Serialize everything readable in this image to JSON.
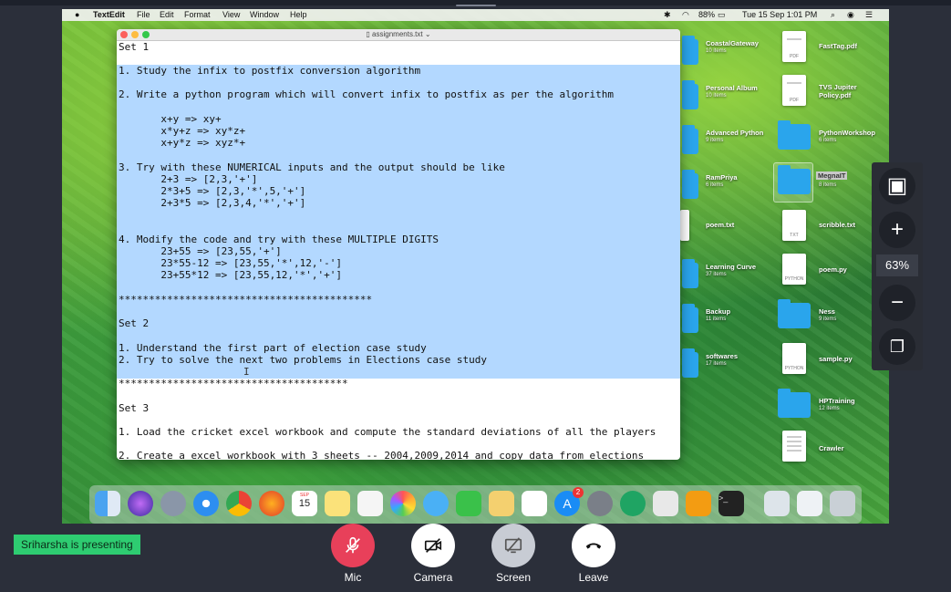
{
  "menubar": {
    "apple": "",
    "app_name": "TextEdit",
    "items": [
      "File",
      "Edit",
      "Format",
      "View",
      "Window",
      "Help"
    ],
    "battery": "88%",
    "datetime": "Tue 15 Sep  1:01 PM"
  },
  "editor": {
    "title": "assignments.txt",
    "lines": [
      "Set 1",
      "",
      "1. Study the infix to postfix conversion algorithm",
      "",
      "2. Write a python program which will convert infix to postfix as per the algorithm",
      "",
      "       x+y => xy+",
      "       x*y+z => xy*z+",
      "       x+y*z => xyz*+",
      "",
      "3. Try with these NUMERICAL inputs and the output should be like",
      "       2+3 => [2,3,'+']",
      "       2*3+5 => [2,3,'*',5,'+']",
      "       2+3*5 => [2,3,4,'*','+']",
      "",
      "",
      "4. Modify the code and try with these MULTIPLE DIGITS",
      "       23+55 => [23,55,'+']",
      "       23*55-12 => [23,55,'*',12,'-']",
      "       23+55*12 => [23,55,12,'*','+']",
      "",
      "******************************************",
      "",
      "Set 2",
      "",
      "1. Understand the first part of election case study",
      "2. Try to solve the next two problems in Elections case study",
      "",
      "**************************************",
      "",
      "Set 3",
      "",
      "1. Load the cricket excel workbook and compute the standard deviations of all the players",
      "",
      "2. Create a excel workbook with 3 sheets -- 2004,2009,2014 and copy data from elections"
    ]
  },
  "desktop": {
    "col1": [
      {
        "name": "CoastalGateway",
        "sub": "10 items"
      },
      {
        "name": "Personal Album",
        "sub": "10 items"
      },
      {
        "name": "Advanced Python",
        "sub": "9 items"
      },
      {
        "name": "RamPriya",
        "sub": "6 items"
      },
      {
        "name": "poem.txt",
        "sub": ""
      },
      {
        "name": "Learning Curve",
        "sub": "37 items"
      },
      {
        "name": "Backup",
        "sub": "11 items"
      },
      {
        "name": "softwares",
        "sub": "17 items"
      }
    ],
    "col2": [
      {
        "name": "FastTag.pdf",
        "sub": "",
        "kind": "PDF"
      },
      {
        "name": "TVS Jupiter Policy.pdf",
        "sub": "",
        "kind": "PDF"
      },
      {
        "name": "PythonWorkshop",
        "sub": "6 items",
        "kind": "folder"
      },
      {
        "name": "MegnaIT",
        "sub": "8 items",
        "kind": "folder"
      },
      {
        "name": "scribble.txt",
        "sub": "",
        "kind": "TXT"
      },
      {
        "name": "poem.py",
        "sub": "",
        "kind": "PYTHON"
      },
      {
        "name": "Ness",
        "sub": "9 items",
        "kind": "folder"
      },
      {
        "name": "sample.py",
        "sub": "",
        "kind": "PYTHON"
      },
      {
        "name": "HPTraining",
        "sub": "12 items",
        "kind": "folder"
      },
      {
        "name": "Crawler",
        "sub": "",
        "kind": "doc"
      }
    ]
  },
  "dock": {
    "calendar_month": "SEP",
    "calendar_day": "15",
    "appstore_badge": "2"
  },
  "zoom": {
    "level": "63%"
  },
  "meeting": {
    "presenter": "Sriharsha is presenting",
    "mic_label": "Mic",
    "camera_label": "Camera",
    "screen_label": "Screen",
    "leave_label": "Leave"
  },
  "colors": {
    "selection": "#b3d8ff",
    "mic": "#e8405a",
    "presenter": "#2ecc71"
  }
}
